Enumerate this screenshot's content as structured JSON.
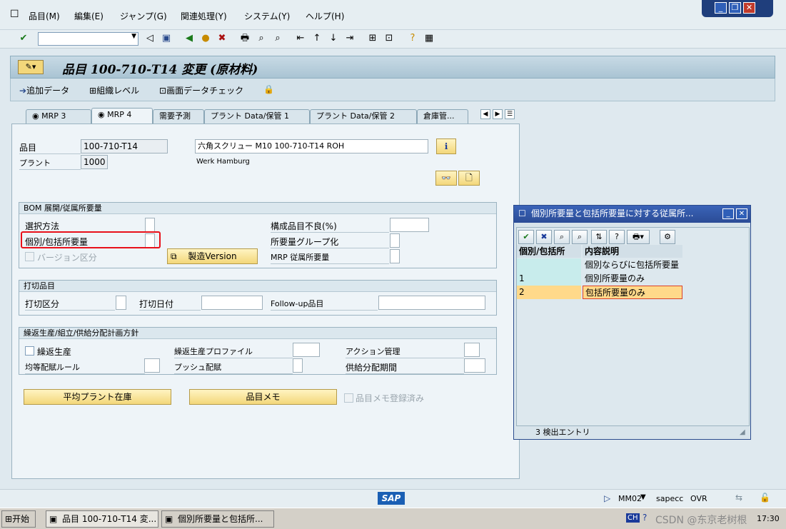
{
  "menu": [
    "品目(M)",
    "編集(E)",
    "ジャンプ(G)",
    "関連処理(Y)",
    "システム(Y)",
    "ヘルプ(H)"
  ],
  "toolbar": {
    "command_value": ""
  },
  "header": {
    "title": "品目 100-710-T14 変更 (原材料)"
  },
  "app_toolbar": {
    "add_data": "追加データ",
    "org_level": "組織レベル",
    "check_screen": "画面データチェック"
  },
  "tabs": [
    "MRP 3",
    "MRP 4",
    "需要予測",
    "プラント Data/保管 1",
    "プラント Data/保管 2",
    "倉庫管..."
  ],
  "material": {
    "label_material": "品目",
    "material_value": "100-710-T14",
    "description_value": "六角スクリュー M10 100-710-T14 ROH",
    "label_plant": "プラント",
    "plant_value": "1000",
    "plant_name": "Werk Hamburg"
  },
  "bom_group": {
    "title": "BOM 展開/従属所要量",
    "selection_method": "選択方法",
    "indiv_coll": "個別/包括所要量",
    "version_indicator": "バージョン区分",
    "prod_version_button": "製造Version",
    "component_scrap": "構成品目不良(%)",
    "req_group": "所要量グループ化",
    "mrp_dep_req": "MRP 従属所要量"
  },
  "discontinued_group": {
    "title": "打切品目",
    "disc_ind": "打切区分",
    "eff_out": "打切日付",
    "follow_up": "Follow-up品目"
  },
  "repetitive_group": {
    "title": "繰返生産/組立/供給分配計画方針",
    "repetitive_mfg": "繰返生産",
    "rem_profile": "繰返生産プロファイル",
    "action_control": "アクション管理",
    "fair_share": "均等配賦ルール",
    "push_dist": "プッシュ配賦",
    "deployment_horizon": "供給分配期間"
  },
  "bottom_buttons": {
    "avg_plant_stock": "平均プラント在庫",
    "material_memo": "品目メモ",
    "memo_exists": "品目メモ登録済み"
  },
  "popup": {
    "title": "個別所要量と包括所要量に対する従属所...",
    "col_key": "個別/包括所",
    "col_desc": "内容説明",
    "rows": [
      {
        "key": "",
        "desc": "個別ならびに包括所要量"
      },
      {
        "key": "1",
        "desc": "個別所要量のみ"
      },
      {
        "key": "2",
        "desc": "包括所要量のみ"
      }
    ],
    "footer": "3 検出エントリ"
  },
  "status": {
    "logo": "SAP",
    "tcode": "MM02",
    "server": "sapecc",
    "mode": "OVR"
  },
  "taskbar": {
    "start": "开始",
    "task1": "品目 100-710-T14 変...",
    "task2": "個別所要量と包括所...",
    "lang": "CH",
    "watermark": "CSDN @东京老树根",
    "clock": "17:30"
  },
  "colors": {
    "highlight_row": "#ffd98a",
    "highlight_box": "#e8101a",
    "title_blue": "#2b4c96"
  }
}
